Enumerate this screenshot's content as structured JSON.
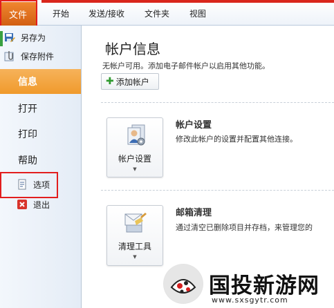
{
  "ribbon": {
    "file_tab": "文件",
    "tabs": [
      "开始",
      "发送/接收",
      "文件夹",
      "视图"
    ]
  },
  "sidebar": {
    "save_as": "另存为",
    "save_attachments": "保存附件",
    "info": "信息",
    "open": "打开",
    "print": "打印",
    "help": "帮助",
    "options": "选项",
    "exit": "退出"
  },
  "main": {
    "title": "帐户信息",
    "subtitle": "无帐户可用。添加电子邮件帐户以启用其他功能。",
    "add_account": "添加帐户",
    "account_settings": {
      "button_label": "帐户设置",
      "heading": "帐户设置",
      "description": "修改此帐户的设置并配置其他连接。"
    },
    "mailbox_cleanup": {
      "button_label": "清理工具",
      "heading": "邮箱清理",
      "description": "通过清空已删除项目并存档，来管理您的"
    }
  },
  "watermark": {
    "text": "国投新游网",
    "url": "www.sxsgytr.com"
  },
  "colors": {
    "file_tab": "#e0701f",
    "active_nav": "#f2a33a",
    "highlight_box": "#e21d1d",
    "green_plus": "#2f9a2f"
  }
}
